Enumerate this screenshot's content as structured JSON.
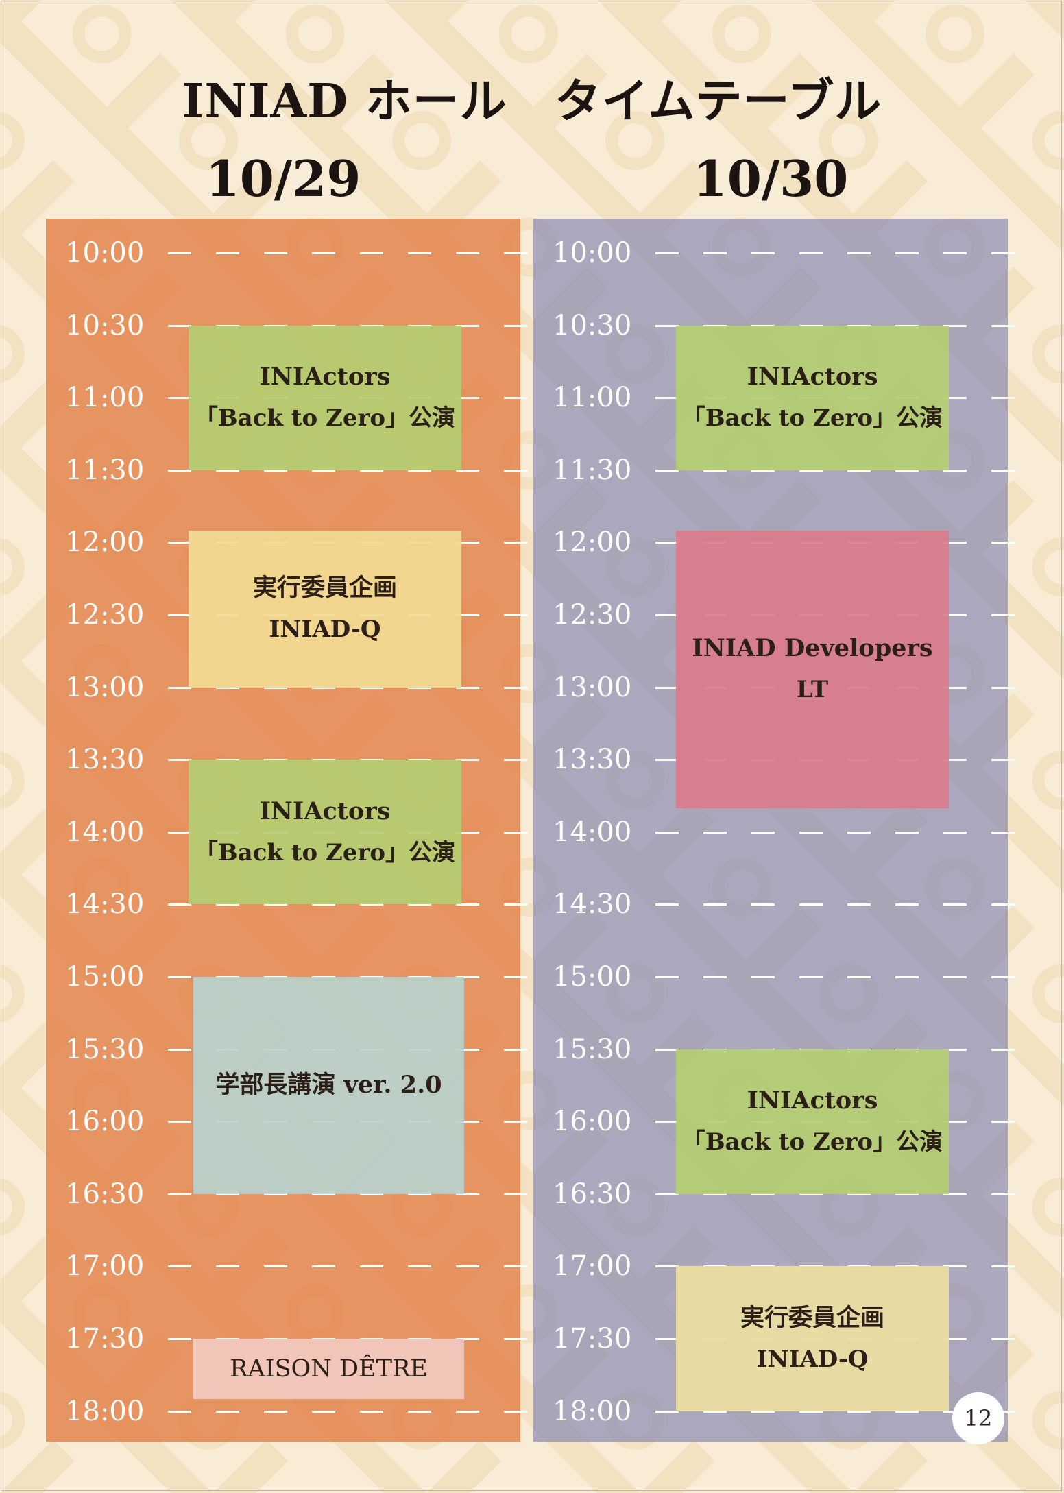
{
  "title": "INIAD ホール　タイムテーブル",
  "days": [
    {
      "date": "10/29"
    },
    {
      "date": "10/30"
    }
  ],
  "times": [
    "10:00",
    "10:30",
    "11:00",
    "11:30",
    "12:00",
    "12:30",
    "13:00",
    "13:30",
    "14:00",
    "14:30",
    "15:00",
    "15:30",
    "16:00",
    "16:30",
    "17:00",
    "17:30",
    "18:00"
  ],
  "day1_events": [
    {
      "start": "10:30",
      "end": "11:30",
      "line1": "INIActors",
      "line2": "「Back to Zero」公演"
    },
    {
      "start": "11:55",
      "end": "13:00",
      "line1": "実行委員企画",
      "line2": "INIAD-Q"
    },
    {
      "start": "13:30",
      "end": "14:30",
      "line1": "INIActors",
      "line2": "「Back to Zero」公演"
    },
    {
      "start": "15:00",
      "end": "16:30",
      "line1": "学部長講演 ver. 2.0",
      "line2": ""
    },
    {
      "start": "17:30",
      "end": "17:55",
      "line1": "RAISON DÊTRE",
      "line2": ""
    }
  ],
  "day2_events": [
    {
      "start": "10:30",
      "end": "11:30",
      "line1": "INIActors",
      "line2": "「Back to Zero」公演"
    },
    {
      "start": "11:55",
      "end": "13:50",
      "line1": "INIAD Developers",
      "line2": "LT"
    },
    {
      "start": "15:30",
      "end": "16:30",
      "line1": "INIActors",
      "line2": "「Back to Zero」公演"
    },
    {
      "start": "17:00",
      "end": "18:00",
      "line1": "実行委員企画",
      "line2": "INIAD-Q"
    }
  ],
  "page_number": "12",
  "colors": {
    "background": "#f9ecd6",
    "day1_column": "#e2a070",
    "day2_column": "#aaa6c0",
    "green_event": "#b4ce72",
    "yellow_event": "#f2da92",
    "teal_event": "#b8d2cd",
    "pink_event": "#f1c8be",
    "red_event": "#da7c8c"
  }
}
